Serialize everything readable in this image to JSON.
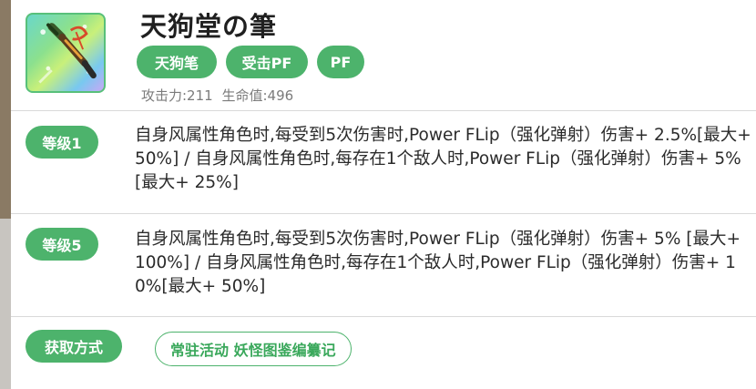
{
  "item": {
    "name": "天狗堂の筆",
    "tags": [
      "天狗笔",
      "受击PF",
      "PF"
    ],
    "stats": {
      "attack": "攻击力:211",
      "hp": "生命值:496"
    }
  },
  "levels": [
    {
      "label": "等级1",
      "text": "自身风属性角色时,每受到5次伤害时,Power FLip（强化弹射）伤害+ 2.5%[最大+ 50%] / 自身风属性角色时,每存在1个敌人时,Power FLip（强化弹射）伤害+ 5%[最大+ 25%]"
    },
    {
      "label": "等级5",
      "text": "自身风属性角色时,每受到5次伤害时,Power FLip（强化弹射）伤害+ 5% [最大+ 100%] / 自身风属性角色时,每存在1个敌人时,Power FLip（强化弹射）伤害+ 10%[最大+ 50%]"
    }
  ],
  "acquire": {
    "label": "获取方式",
    "source": "常驻活动 妖怪图鉴编纂记"
  },
  "icons": {
    "weapon": "brush-weapon-icon"
  },
  "colors": {
    "accent": "#4db36c",
    "text": "#2b2b2b",
    "muted": "#7b7b7b"
  }
}
